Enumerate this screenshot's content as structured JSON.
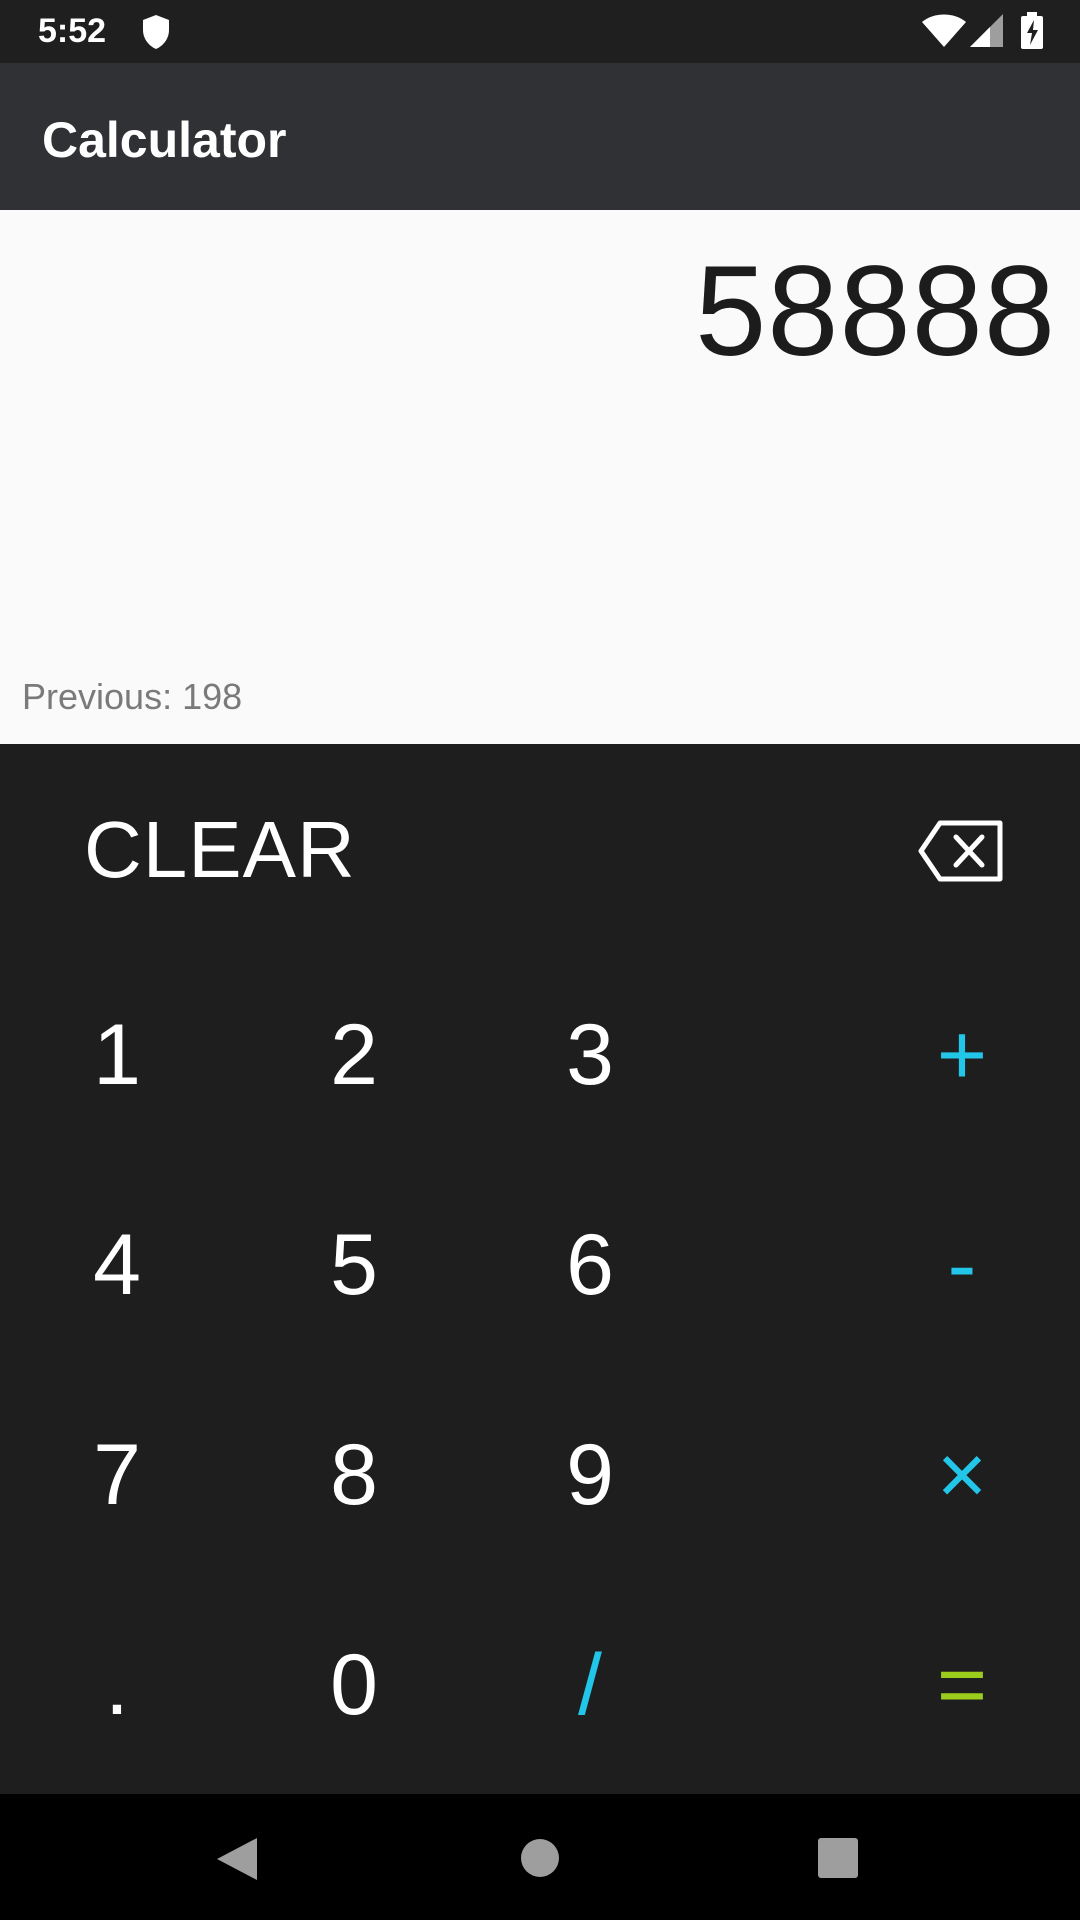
{
  "status_bar": {
    "time": "5:52"
  },
  "app_bar": {
    "title": "Calculator"
  },
  "display": {
    "result": "58888",
    "previous": "Previous: 198"
  },
  "keypad": {
    "clear_label": "CLEAR",
    "keys": {
      "k1": "1",
      "k2": "2",
      "k3": "3",
      "plus": "+",
      "k4": "4",
      "k5": "5",
      "k6": "6",
      "minus": "-",
      "k7": "7",
      "k8": "8",
      "k9": "9",
      "multiply": "×",
      "dot": ".",
      "k0": "0",
      "divide": "/",
      "equals": "="
    }
  },
  "colors": {
    "operator": "#22c6e8",
    "equals": "#9ccc1c"
  },
  "icons": {
    "backspace": "backspace-icon",
    "shield": "shield-icon",
    "wifi": "wifi-icon",
    "signal": "signal-icon",
    "battery": "battery-icon",
    "back": "back-icon",
    "home": "home-icon",
    "recent": "recent-apps-icon"
  }
}
